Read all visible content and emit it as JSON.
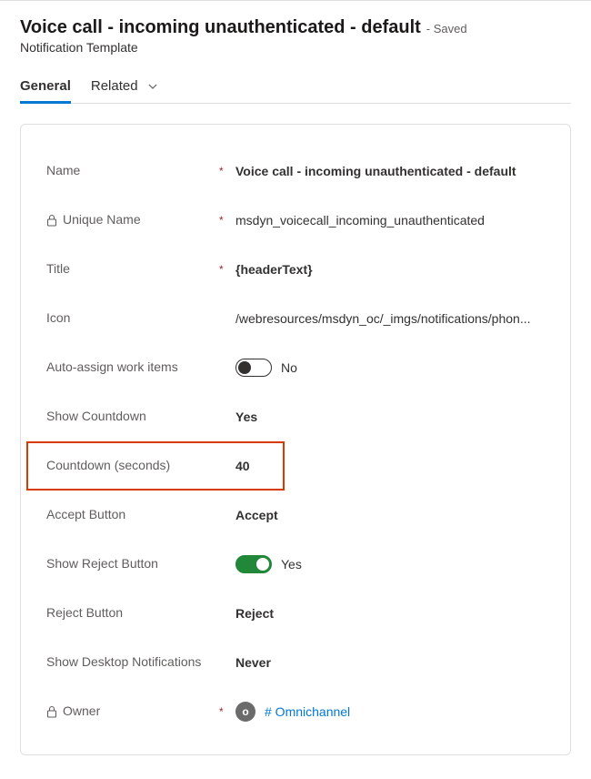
{
  "header": {
    "title": "Voice call - incoming unauthenticated - default",
    "savedSuffix": "- Saved",
    "subtitle": "Notification Template"
  },
  "tabs": {
    "general": "General",
    "related": "Related"
  },
  "form": {
    "name": {
      "label": "Name",
      "value": "Voice call - incoming unauthenticated - default",
      "required": true,
      "locked": false
    },
    "uniqueName": {
      "label": "Unique Name",
      "value": "msdyn_voicecall_incoming_unauthenticated",
      "required": true,
      "locked": true
    },
    "title": {
      "label": "Title",
      "value": "{headerText}",
      "required": true,
      "locked": false
    },
    "icon": {
      "label": "Icon",
      "value": "/webresources/msdyn_oc/_imgs/notifications/phon...",
      "required": false,
      "locked": false
    },
    "autoAssign": {
      "label": "Auto-assign work items",
      "value": "No",
      "on": false,
      "required": false
    },
    "showCountdown": {
      "label": "Show Countdown",
      "value": "Yes",
      "required": false
    },
    "countdownSeconds": {
      "label": "Countdown (seconds)",
      "value": "40",
      "required": false
    },
    "acceptButton": {
      "label": "Accept Button",
      "value": "Accept",
      "required": false
    },
    "showReject": {
      "label": "Show Reject Button",
      "value": "Yes",
      "on": true,
      "required": false
    },
    "rejectButton": {
      "label": "Reject Button",
      "value": "Reject",
      "required": false
    },
    "desktopNotifications": {
      "label": "Show Desktop Notifications",
      "value": "Never",
      "required": false
    },
    "owner": {
      "label": "Owner",
      "value": "# Omnichannel",
      "initial": "o",
      "required": true,
      "locked": true
    }
  }
}
